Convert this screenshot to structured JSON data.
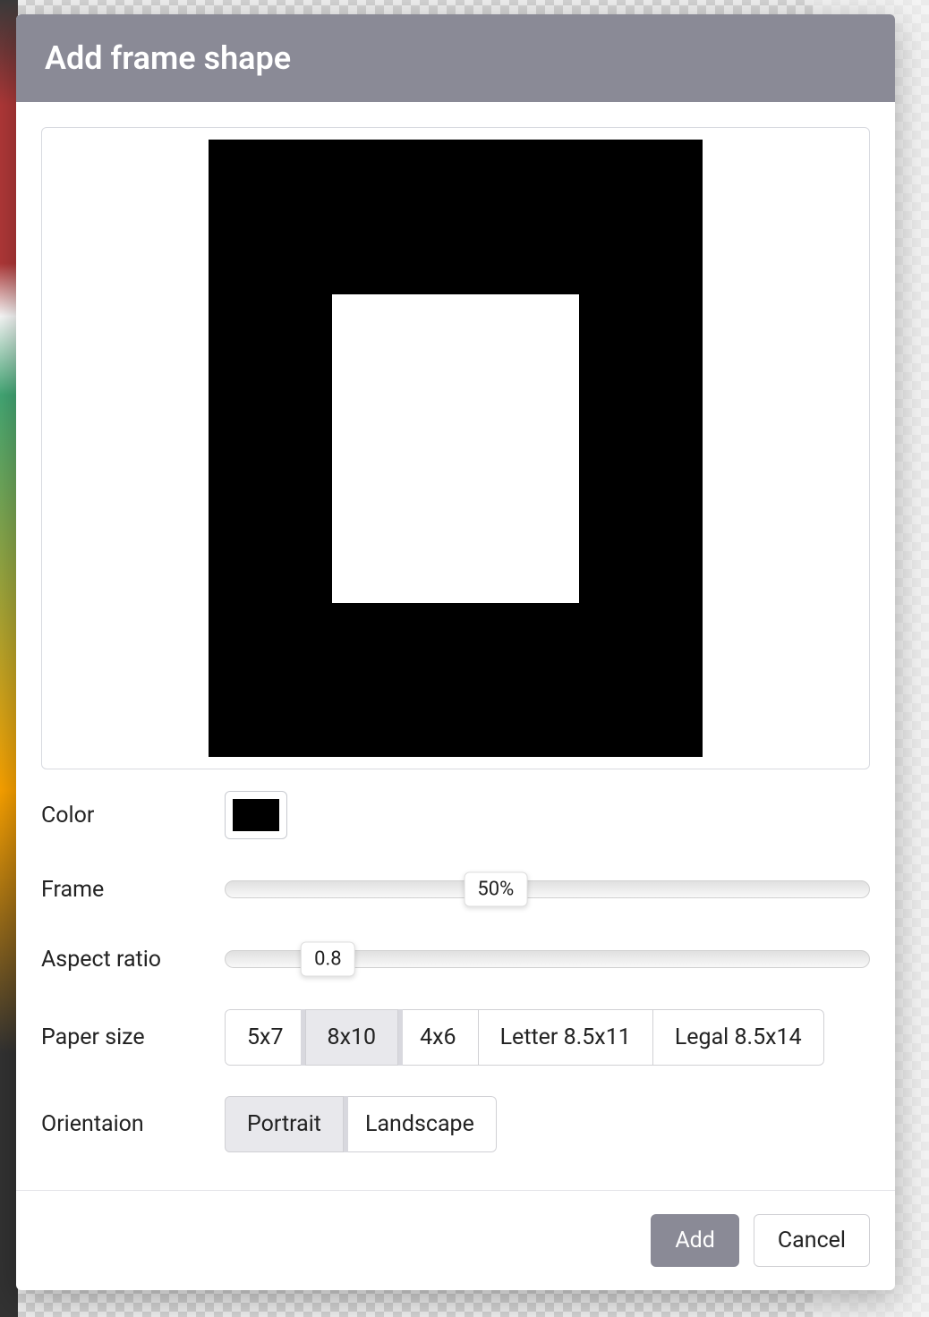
{
  "modal": {
    "title": "Add frame shape"
  },
  "preview": {
    "frame_color": "#000000",
    "frame_thickness_percent": 50,
    "aspect_ratio": 0.8
  },
  "color": {
    "label": "Color",
    "value": "#000000"
  },
  "frame": {
    "label": "Frame",
    "value_display": "50%",
    "value": 50,
    "min": 0,
    "max": 100,
    "thumb_position_percent": 42
  },
  "aspect_ratio": {
    "label": "Aspect ratio",
    "value_display": "0.8",
    "value": 0.8,
    "thumb_position_percent": 16
  },
  "paper_size": {
    "label": "Paper size",
    "options": [
      "5x7",
      "8x10",
      "4x6",
      "Letter 8.5x11",
      "Legal 8.5x14"
    ],
    "selected_index": 1
  },
  "orientation": {
    "label": "Orientaion",
    "options": [
      "Portrait",
      "Landscape"
    ],
    "selected_index": 0
  },
  "footer": {
    "add_label": "Add",
    "cancel_label": "Cancel"
  }
}
